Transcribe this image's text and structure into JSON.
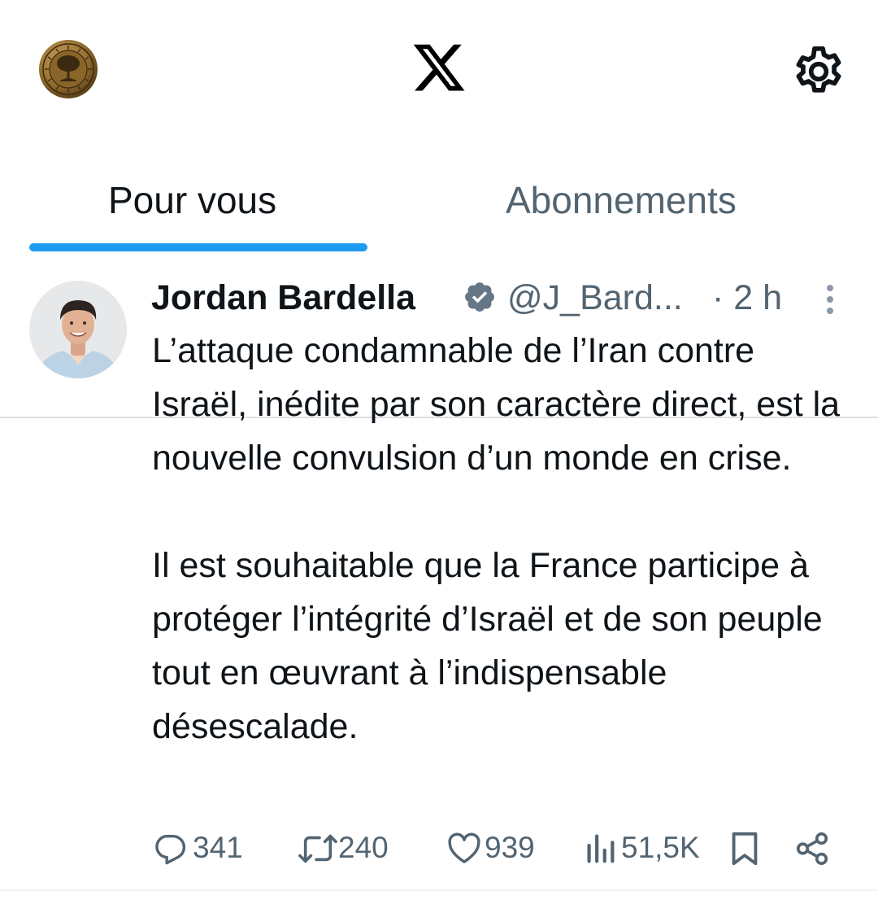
{
  "topbar": {
    "profile_icon": "coin-profile-icon",
    "logo_icon": "x-logo-icon",
    "settings_icon": "gear-icon"
  },
  "tabs": [
    {
      "label": "Pour vous",
      "active": true
    },
    {
      "label": "Abonnements",
      "active": false
    }
  ],
  "tweet": {
    "author_name": "Jordan Bardella",
    "handle": "@J_Bard...",
    "time": "· 2 h",
    "paragraph_1": "L’attaque condamnable de l’Iran contre Israël, inédite par son caractère direct, est la nouvelle convulsion d’un monde en crise.",
    "paragraph_2": "Il est souhaitable que la France participe à protéger l’intégrité d’Israël et de son peuple tout en œuvrant à l’indispensable désescalade.",
    "replies": "341",
    "reposts": "240",
    "likes": "939",
    "views": "51,5K"
  },
  "colors": {
    "accent": "#1d9bf0",
    "text_primary": "#0f1419",
    "text_secondary": "#536471"
  }
}
